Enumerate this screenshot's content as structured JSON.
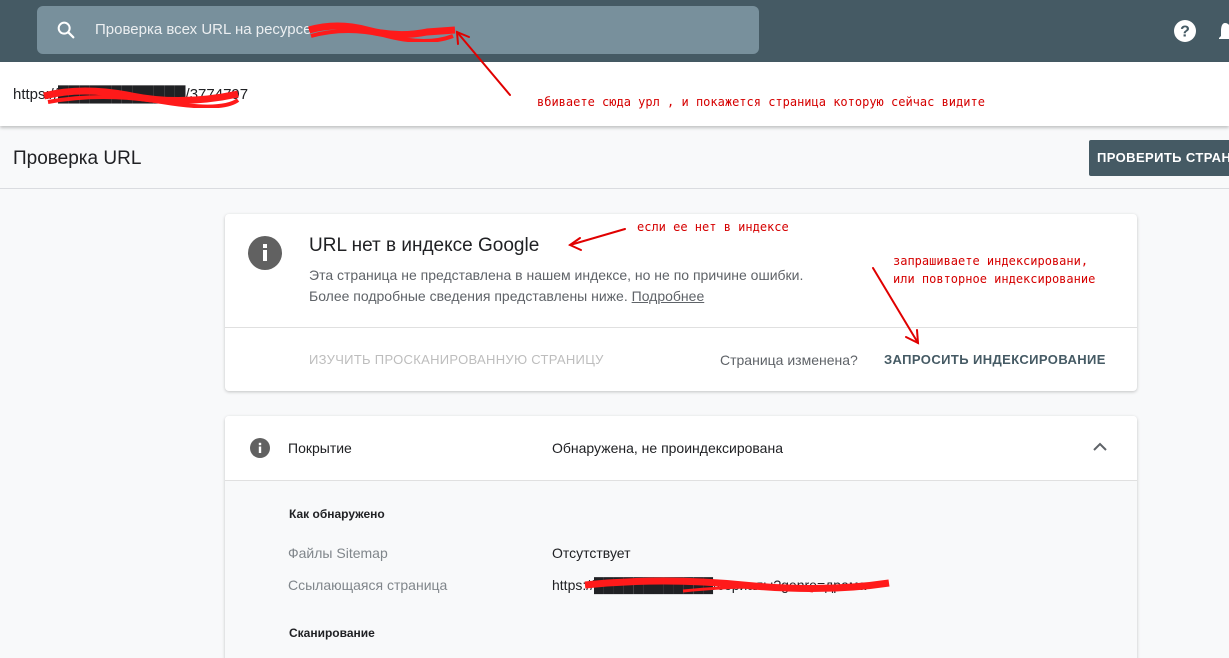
{
  "search": {
    "placeholder": "Проверка всех URL на ресурсе"
  },
  "url_bar": {
    "url": "https://████████████/3774797"
  },
  "annotations": {
    "enter_url": "вбиваете сюда урл , и покажется страница которую сейчас видите",
    "not_in_index": "если ее нет в индексе",
    "request_line1": "запрашиваете индексировани,",
    "request_line2": "или повторное индексирование"
  },
  "page": {
    "title": "Проверка URL",
    "check_button": "ПРОВЕРИТЬ СТРАНИЦУ"
  },
  "status_card": {
    "heading": "URL нет в индексе Google",
    "desc_line1": "Эта страница не представлена в нашем индексе, но не по причине ошибки.",
    "desc_line2": "Более подробные сведения представлены ниже.",
    "more_link": "Подробнее",
    "explore_label": "ИЗУЧИТЬ ПРОСКАНИРОВАННУЮ СТРАНИЦУ",
    "changed_label": "Страница изменена?",
    "request_label": "ЗАПРОСИТЬ ИНДЕКСИРОВАНИЕ"
  },
  "coverage": {
    "label": "Покрытие",
    "value": "Обнаружена, не проиндексирована",
    "discovery_title": "Как обнаружено",
    "sitemaps_label": "Файлы Sitemap",
    "sitemaps_value": "Отсутствует",
    "referring_label": "Ссылающаяся страница",
    "referring_value": "https://████████████/сериалы?genre=драма",
    "crawl_title": "Сканирование"
  },
  "colors": {
    "topbar": "#455a64",
    "accent": "#455a64",
    "annotation": "#d50000"
  }
}
